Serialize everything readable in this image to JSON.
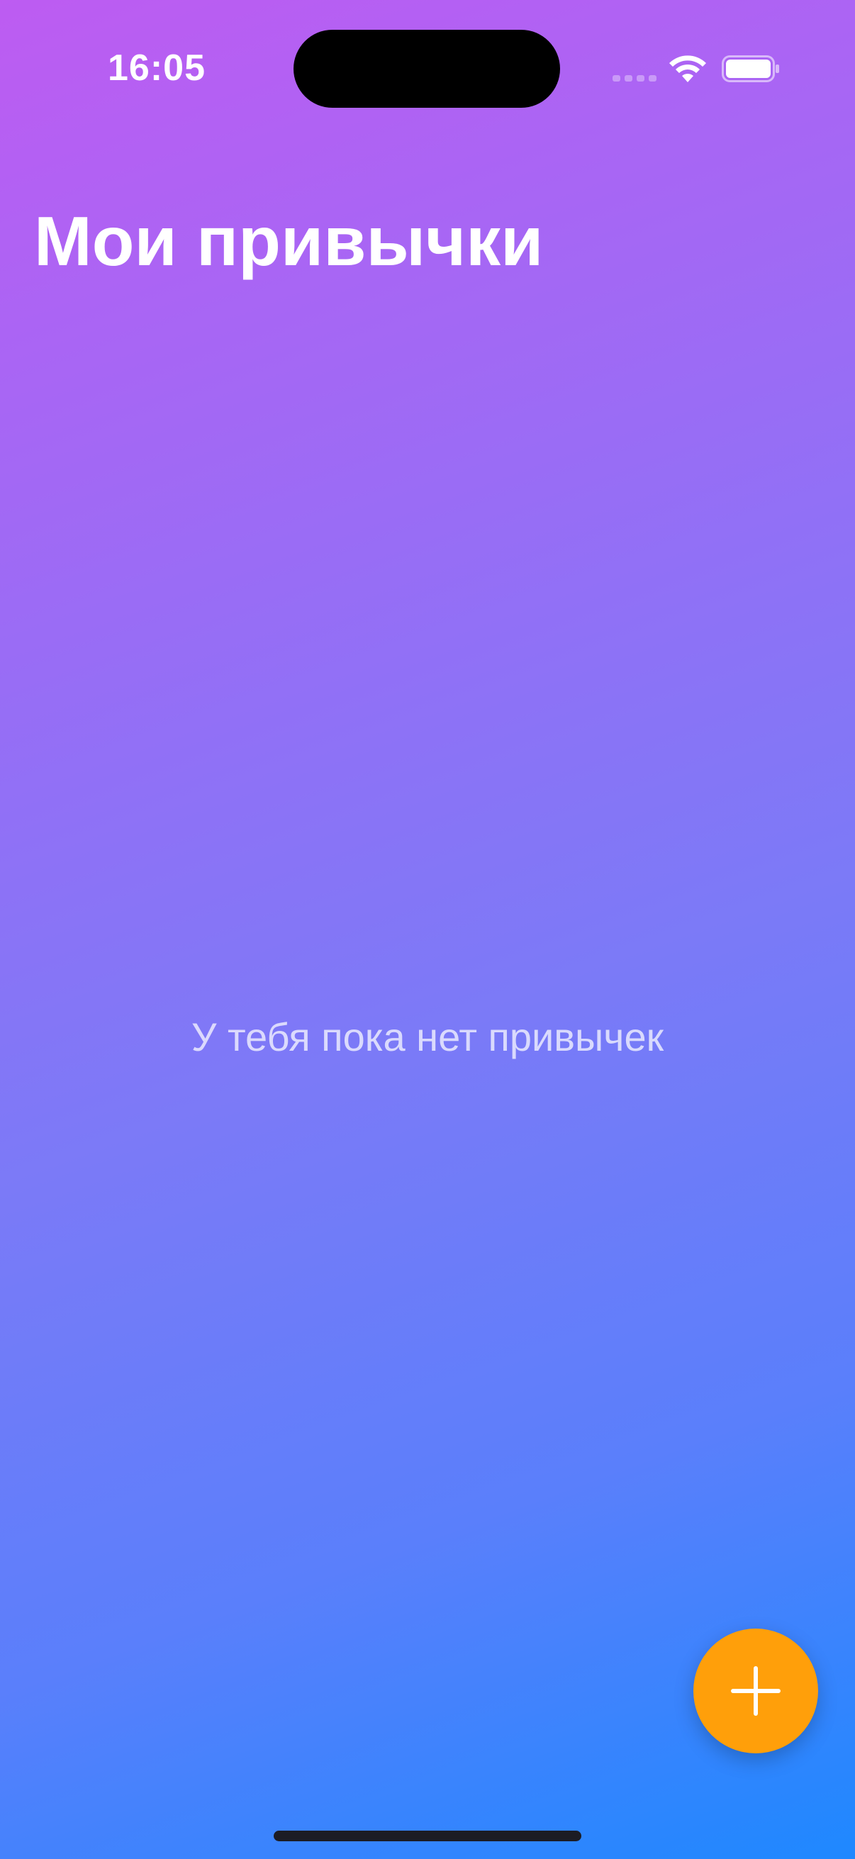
{
  "status_bar": {
    "time": "16:05",
    "icons": [
      "cellular-signal-icon",
      "wifi-icon",
      "battery-icon"
    ]
  },
  "header": {
    "title": "Мои привычки"
  },
  "empty_state": {
    "message": "У тебя пока нет привычек"
  },
  "fab": {
    "icon": "plus-icon",
    "color": "#ff9f0a"
  },
  "colors": {
    "gradient_start": "#bd5cf2",
    "gradient_end": "#1e88ff",
    "accent": "#ff9f0a"
  }
}
